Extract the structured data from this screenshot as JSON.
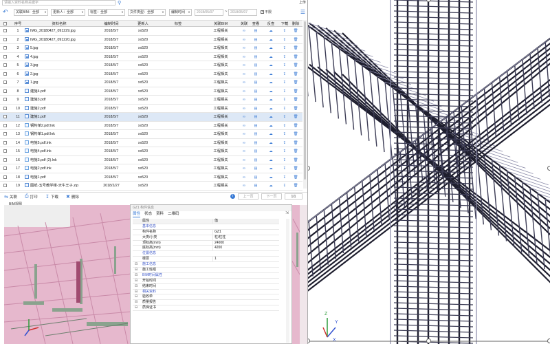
{
  "search": {
    "placeholder": "请输入资料名称关键字",
    "upload_label": "上传"
  },
  "filters": [
    {
      "label": "关联BIM：全部"
    },
    {
      "label": "更新人：全部"
    },
    {
      "label": "标签：全部"
    },
    {
      "label": "文件类型：全部"
    },
    {
      "label": "编制时间"
    }
  ],
  "date_range": {
    "start": "2018/05/07",
    "end": "2018/05/07",
    "tilde": "~",
    "unlimited_label": "不限",
    "unlimited_checked": true
  },
  "table": {
    "headers": [
      "序号",
      "资料名称",
      "编制时间",
      "更新人",
      "标签",
      "关联BIM",
      "关联",
      "查看",
      "反查",
      "下载",
      "删除"
    ],
    "rows": [
      {
        "idx": "1",
        "name": "IMG_20180427_091229.jpg",
        "time": "2018/5/7",
        "user": "xx520",
        "tag": "",
        "bim": "工程相关",
        "type": "img"
      },
      {
        "idx": "2",
        "name": "IMG_20180427_091220.jpg",
        "time": "2018/5/7",
        "user": "xx520",
        "tag": "",
        "bim": "工程相关",
        "type": "img"
      },
      {
        "idx": "3",
        "name": "5.jpg",
        "time": "2018/5/7",
        "user": "xx520",
        "tag": "",
        "bim": "工程相关",
        "type": "img"
      },
      {
        "idx": "4",
        "name": "4.jpg",
        "time": "2018/5/7",
        "user": "xx520",
        "tag": "",
        "bim": "工程相关",
        "type": "img"
      },
      {
        "idx": "5",
        "name": "3.jpg",
        "time": "2018/5/7",
        "user": "xx520",
        "tag": "",
        "bim": "工程相关",
        "type": "img"
      },
      {
        "idx": "6",
        "name": "2.jpg",
        "time": "2018/5/7",
        "user": "xx520",
        "tag": "",
        "bim": "工程相关",
        "type": "img"
      },
      {
        "idx": "7",
        "name": "1.jpg",
        "time": "2018/5/7",
        "user": "xx520",
        "tag": "",
        "bim": "工程相关",
        "type": "img"
      },
      {
        "idx": "8",
        "name": "建施4.pdf",
        "time": "2018/5/7",
        "user": "xx520",
        "tag": "",
        "bim": "工程相关",
        "type": "doc"
      },
      {
        "idx": "9",
        "name": "建施3.pdf",
        "time": "2018/5/7",
        "user": "xx520",
        "tag": "",
        "bim": "工程相关",
        "type": "doc"
      },
      {
        "idx": "10",
        "name": "建施2.pdf",
        "time": "2018/5/7",
        "user": "xx520",
        "tag": "",
        "bim": "工程相关",
        "type": "doc"
      },
      {
        "idx": "11",
        "name": "建施1.pdf",
        "time": "2018/5/7",
        "user": "xx520",
        "tag": "",
        "bim": "工程相关",
        "type": "doc",
        "selected": true
      },
      {
        "idx": "12",
        "name": "钢构单2.pdf.lnk",
        "time": "2018/5/7",
        "user": "xx520",
        "tag": "",
        "bim": "工程相关",
        "type": "lnk"
      },
      {
        "idx": "13",
        "name": "钢构单1.pdf.lnk",
        "time": "2018/5/7",
        "user": "xx520",
        "tag": "",
        "bim": "工程相关",
        "type": "lnk"
      },
      {
        "idx": "14",
        "name": "电施5.pdf.lnk",
        "time": "2018/5/7",
        "user": "xx520",
        "tag": "",
        "bim": "工程相关",
        "type": "lnk"
      },
      {
        "idx": "15",
        "name": "电施4.pdf.lnk",
        "time": "2018/5/7",
        "user": "xx520",
        "tag": "",
        "bim": "工程相关",
        "type": "lnk"
      },
      {
        "idx": "16",
        "name": "电施3.pdf (2).lnk",
        "time": "2018/5/7",
        "user": "xx520",
        "tag": "",
        "bim": "工程相关",
        "type": "lnk"
      },
      {
        "idx": "17",
        "name": "电施2.pdf.lnk",
        "time": "2018/5/7",
        "user": "xx520",
        "tag": "",
        "bim": "工程相关",
        "type": "lnk"
      },
      {
        "idx": "18",
        "name": "电施1.pdf",
        "time": "2018/5/7",
        "user": "xx520",
        "tag": "",
        "bim": "工程相关",
        "type": "doc"
      },
      {
        "idx": "19",
        "name": "图纸-五号教学楼-天牛王子.zip",
        "time": "2018/2/27",
        "user": "xx520",
        "tag": "",
        "bim": "工程相关",
        "type": "doc"
      }
    ]
  },
  "actions": {
    "link": "关联",
    "print": "打印",
    "download": "下载",
    "delete": "删除"
  },
  "pager": {
    "prev": "上一页",
    "next": "下一页",
    "page": "1/1"
  },
  "bim": {
    "label": "BIM视图"
  },
  "props": {
    "title": "GZ1 构件信息",
    "tabs": [
      "属性",
      "状态",
      "资料",
      "二维码"
    ],
    "rows": [
      {
        "k": "属性",
        "v": "值",
        "kind": "head"
      },
      {
        "k": "基本信息",
        "v": "",
        "kind": "group"
      },
      {
        "k": "构件名称",
        "v": "GZ1",
        "kind": "item"
      },
      {
        "k": "大类/小类",
        "v": "柱/柱柱",
        "kind": "item"
      },
      {
        "k": "顶标高(mm)",
        "v": "24000",
        "kind": "item"
      },
      {
        "k": "底标高(mm)",
        "v": "4200",
        "kind": "item"
      },
      {
        "k": "位置信息",
        "v": "",
        "kind": "group"
      },
      {
        "k": "楼层",
        "v": "1",
        "kind": "item"
      },
      {
        "k": "施工信息",
        "v": "",
        "kind": "groupx"
      },
      {
        "k": "施工班组",
        "v": "",
        "kind": "itemx"
      },
      {
        "k": "BIM时间属性",
        "v": "",
        "kind": "groupx"
      },
      {
        "k": "开始时间",
        "v": "",
        "kind": "itemx"
      },
      {
        "k": "结束时间",
        "v": "",
        "kind": "itemx"
      },
      {
        "k": "相关资料",
        "v": "",
        "kind": "groupx"
      },
      {
        "k": "验收单",
        "v": "",
        "kind": "itemx"
      },
      {
        "k": "质量报告",
        "v": "",
        "kind": "itemx"
      },
      {
        "k": "质保证书",
        "v": "",
        "kind": "itemx"
      }
    ]
  },
  "axes": {
    "z": "Z",
    "y": "Y",
    "x": "X"
  }
}
